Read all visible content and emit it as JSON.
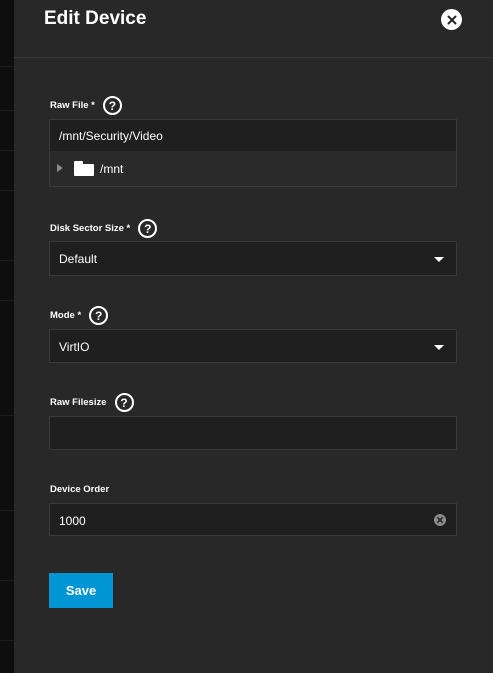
{
  "dialog": {
    "title": "Edit Device",
    "close_icon": "close-icon"
  },
  "form": {
    "raw_file": {
      "label": "Raw File *",
      "value": "/mnt/Security/Video",
      "tree": {
        "folder_label": "/mnt",
        "icon": "folder-icon",
        "expand_icon": "chevron-right-icon"
      }
    },
    "disk_sector_size": {
      "label": "Disk Sector Size *",
      "value": "Default"
    },
    "mode": {
      "label": "Mode *",
      "value": "VirtIO"
    },
    "raw_filesize": {
      "label": "Raw Filesize",
      "value": ""
    },
    "device_order": {
      "label": "Device Order",
      "value": "1000"
    },
    "help_glyph": "?"
  },
  "actions": {
    "save_label": "Save",
    "save_color": "#0095d5"
  }
}
